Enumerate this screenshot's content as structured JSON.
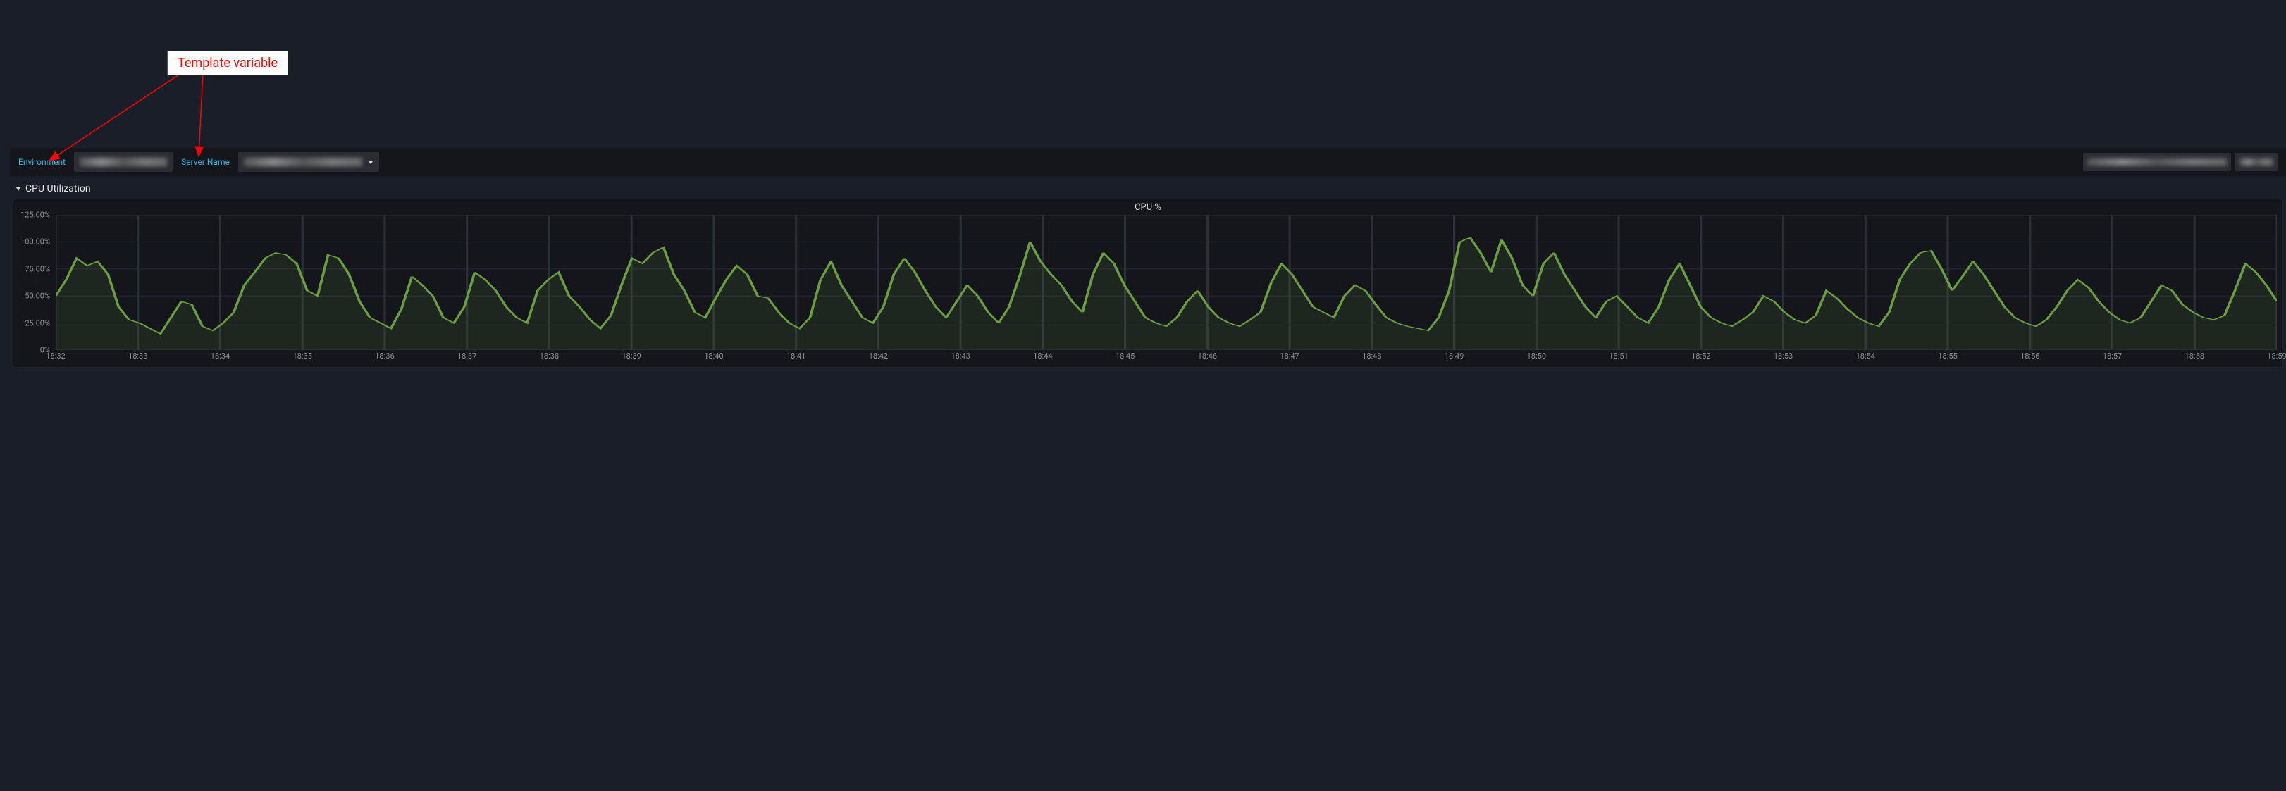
{
  "annotation": {
    "label": "Template variable"
  },
  "variables": {
    "env_label": "Environment",
    "server_label": "Server Name"
  },
  "row": {
    "title": "CPU Utilization"
  },
  "panel": {
    "title": "CPU %"
  },
  "colors": {
    "accent": "#33b5e5",
    "series": "#6a9e3f",
    "annotation_text": "#ff0000",
    "bg": "#1a1e28",
    "panel_bg": "#14161c"
  },
  "chart_data": {
    "type": "line",
    "xlabel": "",
    "ylabel": "",
    "ylim": [
      0,
      125
    ],
    "y_ticks": [
      "0%",
      "25.00%",
      "50.00%",
      "75.00%",
      "100.00%",
      "125.00%"
    ],
    "x_ticks": [
      "18:32",
      "18:33",
      "18:34",
      "18:35",
      "18:36",
      "18:37",
      "18:38",
      "18:39",
      "18:40",
      "18:41",
      "18:42",
      "18:43",
      "18:44",
      "18:45",
      "18:46",
      "18:47",
      "18:48",
      "18:49",
      "18:50",
      "18:51",
      "18:52",
      "18:53",
      "18:54",
      "18:55",
      "18:56",
      "18:57",
      "18:58",
      "18:59"
    ],
    "series": [
      {
        "name": "CPU %",
        "values": [
          50,
          65,
          85,
          78,
          82,
          70,
          40,
          28,
          25,
          20,
          15,
          30,
          45,
          42,
          22,
          18,
          25,
          35,
          60,
          72,
          85,
          90,
          88,
          80,
          55,
          50,
          88,
          85,
          70,
          45,
          30,
          25,
          20,
          38,
          68,
          60,
          50,
          30,
          25,
          40,
          72,
          65,
          55,
          40,
          30,
          25,
          55,
          65,
          72,
          50,
          40,
          28,
          20,
          32,
          60,
          85,
          80,
          90,
          95,
          70,
          55,
          35,
          30,
          48,
          65,
          78,
          70,
          50,
          48,
          35,
          25,
          20,
          30,
          65,
          82,
          60,
          45,
          30,
          25,
          40,
          70,
          85,
          72,
          55,
          40,
          30,
          45,
          60,
          50,
          35,
          25,
          40,
          68,
          100,
          82,
          70,
          60,
          45,
          35,
          70,
          90,
          80,
          60,
          45,
          30,
          25,
          22,
          30,
          45,
          55,
          40,
          30,
          25,
          22,
          28,
          35,
          62,
          80,
          70,
          55,
          40,
          35,
          30,
          50,
          60,
          55,
          42,
          30,
          25,
          22,
          20,
          18,
          30,
          55,
          100,
          104,
          90,
          72,
          102,
          85,
          60,
          50,
          80,
          90,
          70,
          55,
          40,
          30,
          45,
          50,
          40,
          30,
          25,
          40,
          65,
          80,
          60,
          40,
          30,
          25,
          22,
          28,
          35,
          50,
          45,
          35,
          28,
          25,
          32,
          55,
          48,
          38,
          30,
          25,
          22,
          35,
          65,
          80,
          90,
          92,
          75,
          55,
          68,
          82,
          70,
          55,
          40,
          30,
          25,
          22,
          28,
          40,
          55,
          65,
          58,
          45,
          35,
          28,
          25,
          30,
          45,
          60,
          55,
          42,
          35,
          30,
          28,
          32,
          55,
          80,
          72,
          60,
          45
        ]
      }
    ]
  }
}
